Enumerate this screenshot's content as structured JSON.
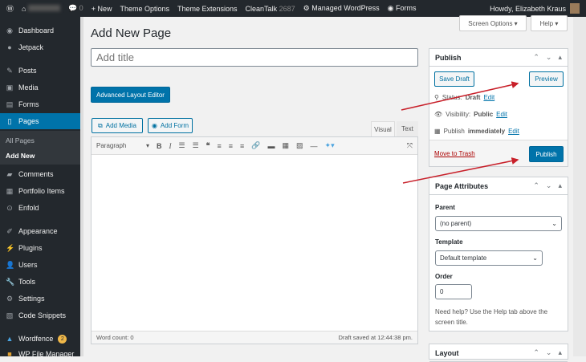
{
  "adminbar": {
    "comments": "0",
    "new": "New",
    "items": [
      "Theme Options",
      "Theme Extensions",
      "CleanTalk"
    ],
    "cleantalk_count": "2687",
    "managed": "Managed WordPress",
    "forms": "Forms",
    "howdy": "Howdy, Elizabeth Kraus"
  },
  "sidebar": {
    "items": [
      "Dashboard",
      "Jetpack",
      "Posts",
      "Media",
      "Forms",
      "Pages",
      "Comments",
      "Portfolio Items",
      "Enfold",
      "Appearance",
      "Plugins",
      "Users",
      "Tools",
      "Settings",
      "Code Snippets",
      "Wordfence",
      "WP File Manager"
    ],
    "submenu": [
      "All Pages",
      "Add New"
    ],
    "wordfence_badge": "2"
  },
  "header": {
    "screen_options": "Screen Options ▾",
    "help": "Help ▾",
    "title": "Add New Page"
  },
  "editor": {
    "title_placeholder": "Add title",
    "advanced": "Advanced Layout Editor",
    "add_media": "Add Media",
    "add_form": "Add Form",
    "tab_visual": "Visual",
    "tab_text": "Text",
    "format": "Paragraph",
    "word_count": "Word count: 0",
    "draft_saved": "Draft saved at 12:44:38 pm."
  },
  "publish": {
    "title": "Publish",
    "save_draft": "Save Draft",
    "preview": "Preview",
    "status_label": "Status:",
    "status": "Draft",
    "visibility_label": "Visibility:",
    "visibility": "Public",
    "publish_label": "Publish",
    "publish_when": "immediately",
    "edit": "Edit",
    "trash": "Move to Trash",
    "publish_btn": "Publish"
  },
  "attributes": {
    "title": "Page Attributes",
    "parent_label": "Parent",
    "parent": "(no parent)",
    "template_label": "Template",
    "template": "Default template",
    "order_label": "Order",
    "order": "0",
    "help": "Need help? Use the Help tab above the screen title."
  },
  "layout": {
    "title": "Layout"
  },
  "colors": {
    "accent": "#0073aa",
    "arrow": "#c8202a"
  }
}
